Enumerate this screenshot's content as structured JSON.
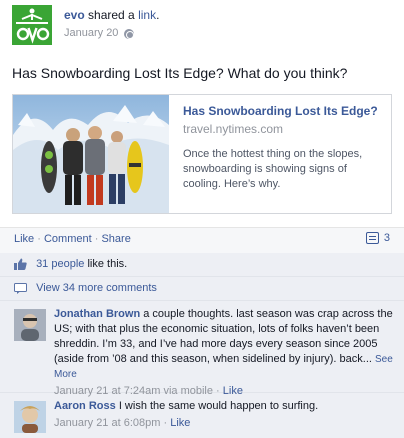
{
  "post": {
    "author": "evo",
    "action_text": "shared a",
    "action_link": "link",
    "action_period": ".",
    "date": "January 20",
    "status": "Has Snowboarding Lost Its Edge? What do you think?"
  },
  "preview": {
    "title": "Has Snowboarding Lost Its Edge?",
    "domain": "travel.nytimes.com",
    "description": "Once the hottest thing on the slopes, snowboarding is showing signs of cooling. Here’s why."
  },
  "actions": {
    "like": "Like",
    "comment": "Comment",
    "share": "Share",
    "separator": "·",
    "comment_count": "3"
  },
  "likes": {
    "people": "31 people",
    "suffix": "like this."
  },
  "view_more": "View 34 more comments",
  "comments": [
    {
      "author": "Jonathan Brown",
      "text": "a couple thoughts. last season was crap across the US; with that plus the economic situation, lots of folks haven’t been shreddin. I’m 33, and I’ve had more days every season since 2005 (aside from ’08 and this season, when sidelined by injury). back...",
      "see_more": "See More",
      "time": "January 21 at 7:24am via mobile",
      "like": "Like"
    },
    {
      "author": "Aaron Ross",
      "text": "I wish the same would happen to surfing.",
      "time": "January 21 at 6:08pm",
      "like": "Like"
    }
  ],
  "colors": {
    "brand_green": "#3aa535",
    "link_blue": "#3b5998",
    "feedback_bg": "#edeff4"
  }
}
